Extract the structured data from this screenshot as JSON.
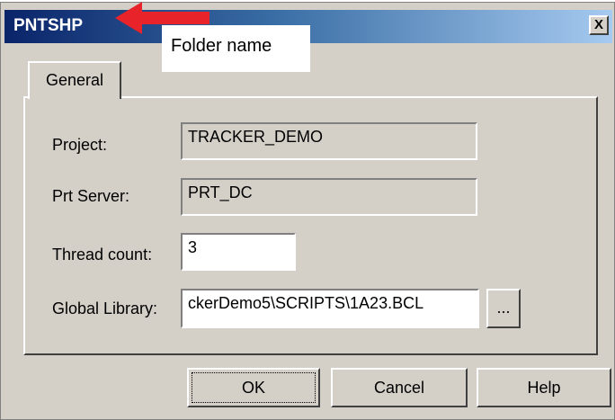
{
  "window": {
    "title": "PNTSHP",
    "close_label": "X"
  },
  "annotation": {
    "text": "Folder name",
    "arrow_color": "#e8232a"
  },
  "tabs": [
    {
      "label": "General"
    }
  ],
  "form": {
    "project": {
      "label": "Project:",
      "value": "TRACKER_DEMO"
    },
    "prt_server": {
      "label": "Prt Server:",
      "value": "PRT_DC"
    },
    "thread_count": {
      "label": "Thread count:",
      "value": "3"
    },
    "global_library": {
      "label": "Global Library:",
      "value": "ckerDemo5\\SCRIPTS\\1A23.BCL",
      "browse_label": "..."
    }
  },
  "buttons": {
    "ok": "OK",
    "cancel": "Cancel",
    "help": "Help"
  },
  "colors": {
    "titlebar_start": "#0a246a",
    "titlebar_end": "#a6caf0",
    "dialog_bg": "#d4d0c8"
  }
}
